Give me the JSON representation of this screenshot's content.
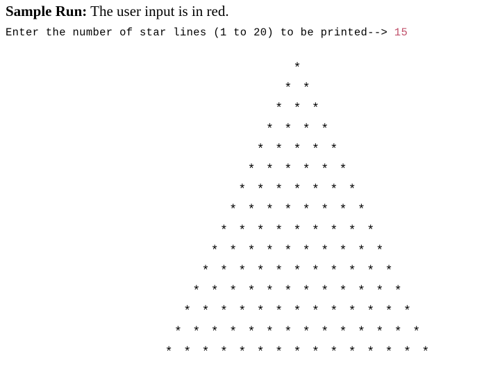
{
  "heading": {
    "label": "Sample Run:",
    "text": " The user input is in red."
  },
  "console": {
    "prompt": "Enter the number of star lines (1 to 20) to be printed--> ",
    "user_input": "15",
    "user_input_color": "#c0506a",
    "star_char": "*",
    "star_lines": 15
  }
}
